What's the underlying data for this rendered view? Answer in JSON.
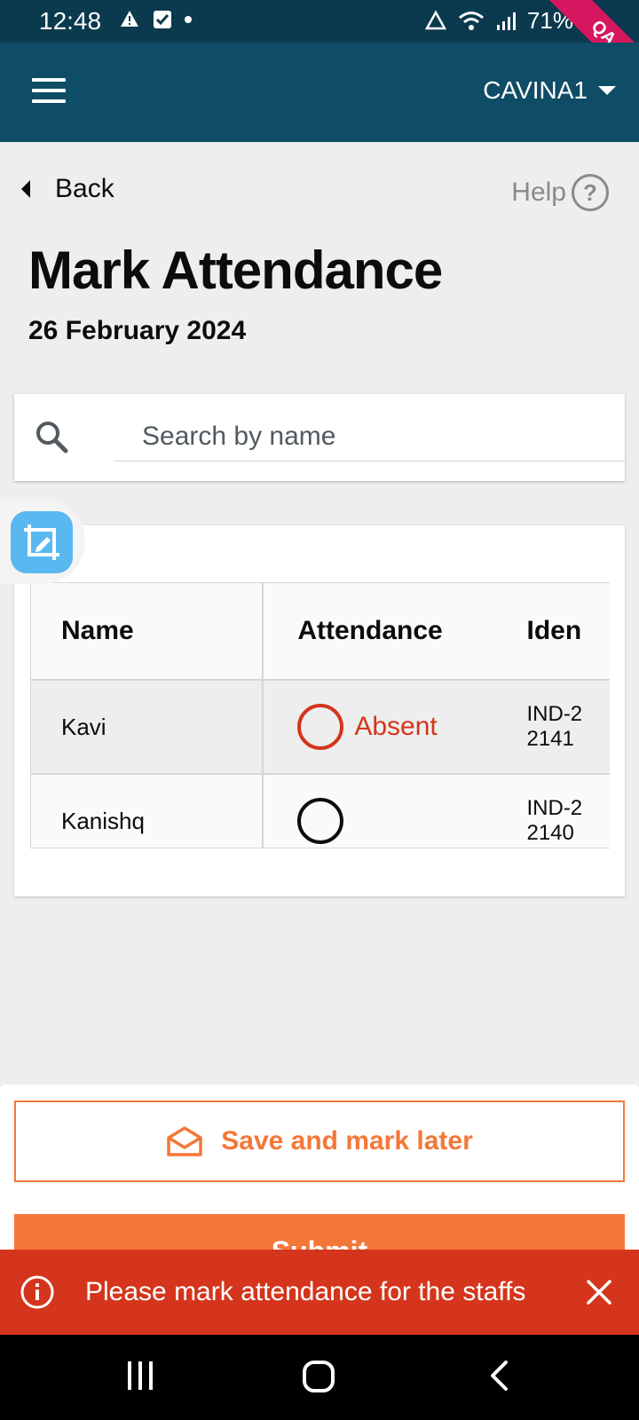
{
  "status_bar": {
    "time": "12:48",
    "battery": "71%",
    "ribbon": "QA",
    "icons_left": [
      "drive-warning-icon",
      "checkbox-notification-icon",
      "dot-icon"
    ],
    "icons_right": [
      "sync-icon",
      "wifi-icon",
      "signal-icon",
      "battery-icon"
    ]
  },
  "app_bar": {
    "tenant": "CAVINA1"
  },
  "nav": {
    "back_label": "Back",
    "help_label": "Help",
    "help_glyph": "?"
  },
  "page": {
    "title": "Mark Attendance",
    "date": "26 February 2024"
  },
  "search": {
    "placeholder": "Search by name"
  },
  "table": {
    "headers": [
      "Name",
      "Attendance",
      "Iden"
    ],
    "rows": [
      {
        "name": "Kavi",
        "status": "Absent",
        "id_line1": "IND-2",
        "id_line2": "2141"
      },
      {
        "name": "Kanishq",
        "status": "",
        "id_line1": "IND-2",
        "id_line2": "2140"
      }
    ]
  },
  "actions": {
    "save_later_label": "Save and mark later",
    "submit_label": "Submit"
  },
  "toast": {
    "message": "Please mark attendance for the staffs"
  },
  "colors": {
    "app_bar": "#0f4c66",
    "accent": "#f47738",
    "error": "#d4351c",
    "fab": "#5ab8f0"
  }
}
